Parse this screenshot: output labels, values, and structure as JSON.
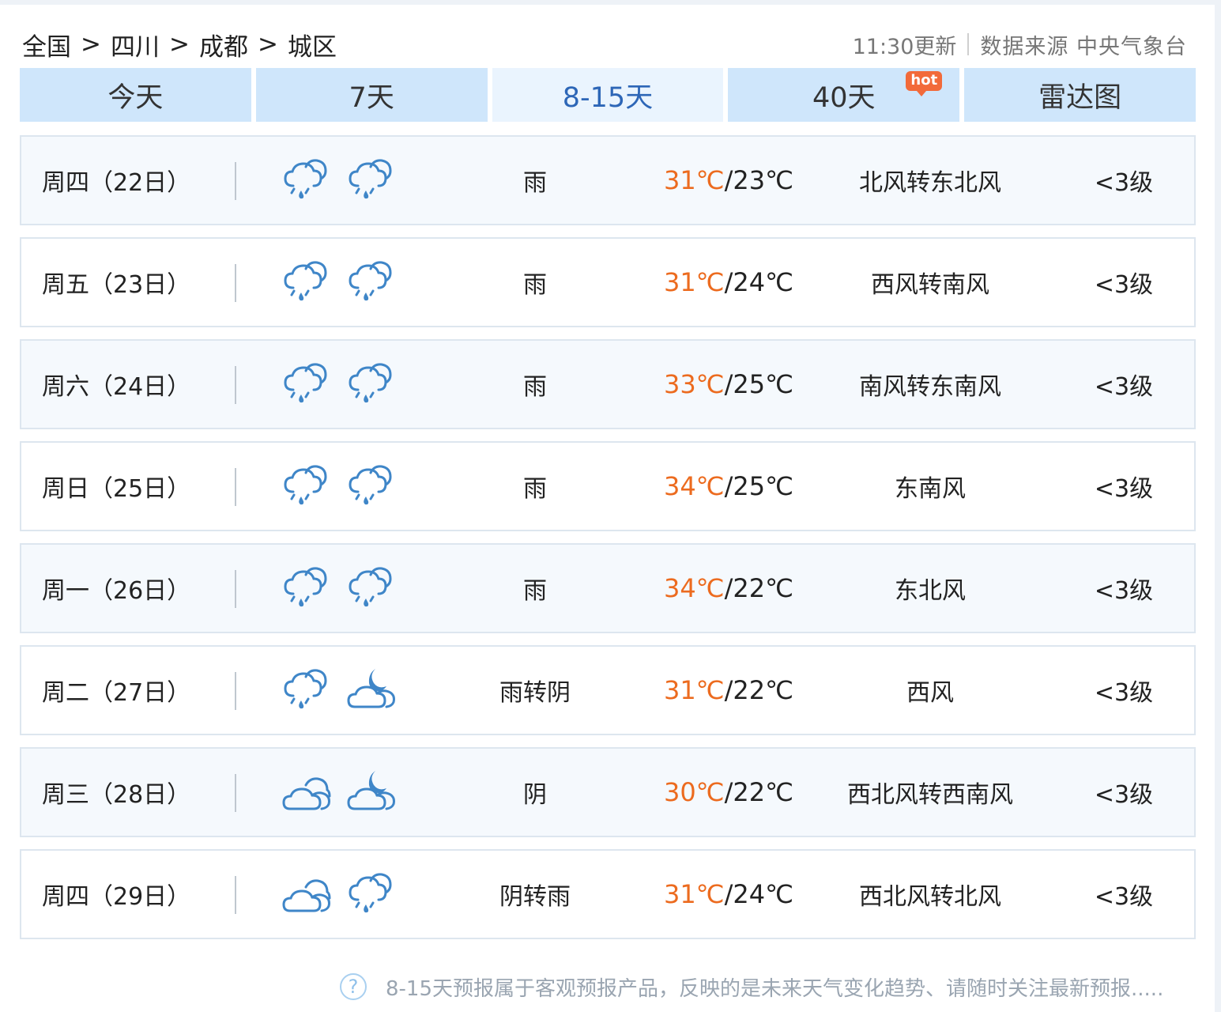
{
  "breadcrumb": {
    "items": [
      "全国",
      "四川",
      "成都",
      "城区"
    ],
    "separator": ">"
  },
  "update": {
    "time_text": "11:30更新",
    "source_text": "数据来源 中央气象台"
  },
  "tabs": [
    {
      "label": "今天",
      "active": false
    },
    {
      "label": "7天",
      "active": false
    },
    {
      "label": "8-15天",
      "active": true
    },
    {
      "label": "40天",
      "active": false,
      "badge": "hot"
    },
    {
      "label": "雷达图",
      "active": false
    }
  ],
  "forecast": [
    {
      "date": "周四（22日）",
      "icons": [
        "rain-icon",
        "rain-icon"
      ],
      "desc": "雨",
      "high": "31℃",
      "low": "23℃",
      "wind": "北风转东北风",
      "level": "<3级"
    },
    {
      "date": "周五（23日）",
      "icons": [
        "rain-icon",
        "rain-icon"
      ],
      "desc": "雨",
      "high": "31℃",
      "low": "24℃",
      "wind": "西风转南风",
      "level": "<3级"
    },
    {
      "date": "周六（24日）",
      "icons": [
        "rain-icon",
        "rain-icon"
      ],
      "desc": "雨",
      "high": "33℃",
      "low": "25℃",
      "wind": "南风转东南风",
      "level": "<3级"
    },
    {
      "date": "周日（25日）",
      "icons": [
        "rain-icon",
        "rain-icon"
      ],
      "desc": "雨",
      "high": "34℃",
      "low": "25℃",
      "wind": "东南风",
      "level": "<3级"
    },
    {
      "date": "周一（26日）",
      "icons": [
        "rain-icon",
        "rain-icon"
      ],
      "desc": "雨",
      "high": "34℃",
      "low": "22℃",
      "wind": "东北风",
      "level": "<3级"
    },
    {
      "date": "周二（27日）",
      "icons": [
        "rain-icon",
        "cloudy-night-icon"
      ],
      "desc": "雨转阴",
      "high": "31℃",
      "low": "22℃",
      "wind": "西风",
      "level": "<3级"
    },
    {
      "date": "周三（28日）",
      "icons": [
        "overcast-icon",
        "cloudy-night-icon"
      ],
      "desc": "阴",
      "high": "30℃",
      "low": "22℃",
      "wind": "西北风转西南风",
      "level": "<3级"
    },
    {
      "date": "周四（29日）",
      "icons": [
        "overcast-icon",
        "rain-icon"
      ],
      "desc": "阴转雨",
      "high": "31℃",
      "low": "24℃",
      "wind": "西北风转北风",
      "level": "<3级"
    }
  ],
  "note": {
    "icon": "question-icon",
    "text": "8-15天预报属于客观预报产品，反映的是未来天气变化趋势、请随时关注最新预报....."
  },
  "colors": {
    "tab_bg": "#cfe6fb",
    "tab_active_bg": "#eaf4fe",
    "tab_active_text": "#2d66b7",
    "high_temp": "#ec6b1f",
    "hot_badge": "#f26a3a",
    "icon_stroke": "#3f86c8"
  }
}
